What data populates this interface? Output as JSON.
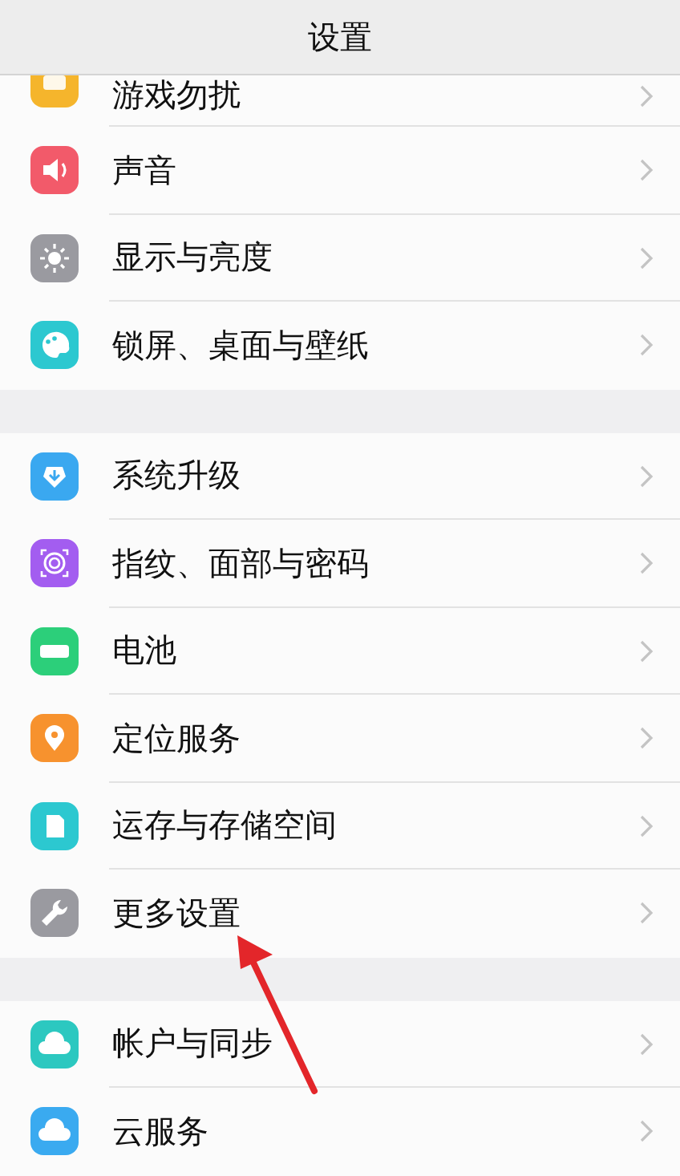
{
  "header": {
    "title": "设置"
  },
  "sections": [
    {
      "items": [
        {
          "label": "游戏勿扰",
          "color": "#f5b52c"
        },
        {
          "label": "声音",
          "color": "#f25a6a"
        },
        {
          "label": "显示与亮度",
          "color": "#9a9aa0"
        },
        {
          "label": "锁屏、桌面与壁纸",
          "color": "#2cc8d0"
        }
      ]
    },
    {
      "items": [
        {
          "label": "系统升级",
          "color": "#3aa8f0"
        },
        {
          "label": "指纹、面部与密码",
          "color": "#a35df0"
        },
        {
          "label": "电池",
          "color": "#2ccf7a"
        },
        {
          "label": "定位服务",
          "color": "#f7922e"
        },
        {
          "label": "运存与存储空间",
          "color": "#2cc8d0"
        },
        {
          "label": "更多设置",
          "color": "#9a9aa0"
        }
      ]
    },
    {
      "items": [
        {
          "label": "帐户与同步",
          "color": "#2cc8c0"
        },
        {
          "label": "云服务",
          "color": "#3aaaf0"
        }
      ]
    }
  ],
  "annotations": [
    {
      "kind": "arrow",
      "color": "#e3262a"
    }
  ]
}
